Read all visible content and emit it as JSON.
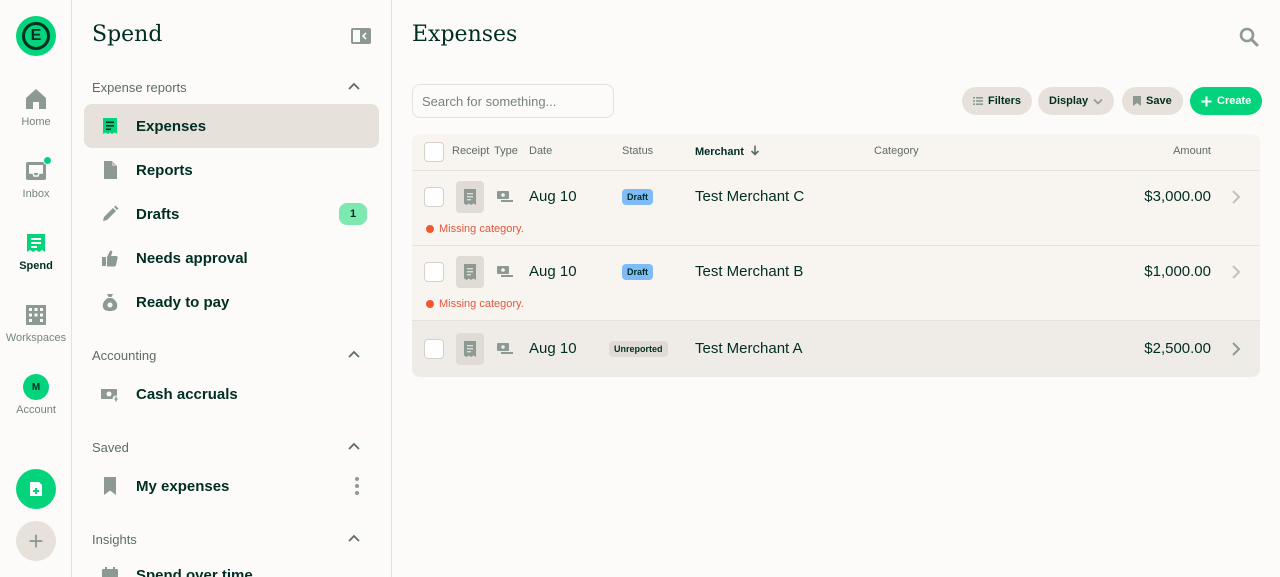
{
  "rail": {
    "logo_letter": "E",
    "items": [
      {
        "label": "Home",
        "icon": "home-icon"
      },
      {
        "label": "Inbox",
        "icon": "inbox-icon"
      },
      {
        "label": "Spend",
        "icon": "receipt-icon"
      },
      {
        "label": "Workspaces",
        "icon": "building-icon"
      },
      {
        "label": "Account",
        "icon": "avatar",
        "avatar_initial": "M"
      }
    ],
    "fab_new": "new-expense-icon",
    "fab_add": "+"
  },
  "sidebar": {
    "title": "Spend",
    "sections": [
      {
        "title": "Expense reports",
        "items": [
          {
            "label": "Expenses",
            "icon": "receipt-icon"
          },
          {
            "label": "Reports",
            "icon": "document-icon"
          },
          {
            "label": "Drafts",
            "icon": "pencil-icon",
            "count": "1"
          },
          {
            "label": "Needs approval",
            "icon": "thumbs-up-icon"
          },
          {
            "label": "Ready to pay",
            "icon": "money-bag-icon"
          }
        ]
      },
      {
        "title": "Accounting",
        "items": [
          {
            "label": "Cash accruals",
            "icon": "cash-icon"
          }
        ]
      },
      {
        "title": "Saved",
        "items": [
          {
            "label": "My expenses",
            "icon": "bookmark-icon"
          }
        ]
      },
      {
        "title": "Insights",
        "items": [
          {
            "label": "Spend over time",
            "icon": "calendar-icon"
          }
        ]
      }
    ]
  },
  "main": {
    "title": "Expenses",
    "search_placeholder": "Search for something...",
    "toolbar": {
      "filters": "Filters",
      "display": "Display",
      "save": "Save",
      "create": "Create"
    },
    "columns": {
      "receipt": "Receipt",
      "type": "Type",
      "date": "Date",
      "status": "Status",
      "merchant": "Merchant",
      "category": "Category",
      "amount": "Amount"
    },
    "rows": [
      {
        "date": "Aug 10",
        "status": "Draft",
        "merchant": "Test Merchant C",
        "amount": "$3,000.00",
        "violation": "Missing category."
      },
      {
        "date": "Aug 10",
        "status": "Draft",
        "merchant": "Test Merchant B",
        "amount": "$1,000.00",
        "violation": "Missing category."
      },
      {
        "date": "Aug 10",
        "status": "Unreported",
        "merchant": "Test Merchant A",
        "amount": "$2,500.00",
        "violation": ""
      }
    ]
  },
  "colors": {
    "accent": "#03D47C",
    "text": "#002E22",
    "draft_badge": "#7EBBF7",
    "error": "#E5573A",
    "background": "#FCFBF9"
  }
}
